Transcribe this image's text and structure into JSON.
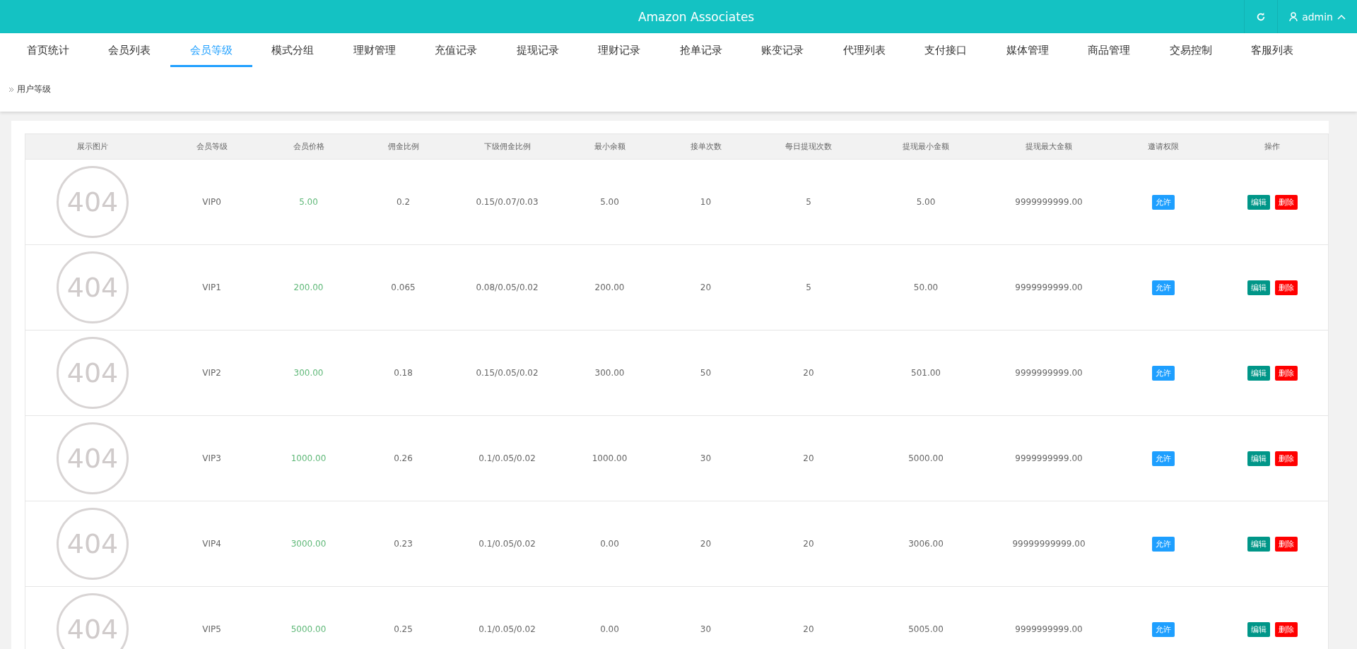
{
  "header": {
    "title": "Amazon Associates",
    "user": "admin"
  },
  "nav": [
    {
      "label": "首页统计",
      "selected": false
    },
    {
      "label": "会员列表",
      "selected": false
    },
    {
      "label": "会员等级",
      "selected": true
    },
    {
      "label": "模式分组",
      "selected": false
    },
    {
      "label": "理财管理",
      "selected": false
    },
    {
      "label": "充值记录",
      "selected": false
    },
    {
      "label": "提现记录",
      "selected": false
    },
    {
      "label": "理财记录",
      "selected": false
    },
    {
      "label": "抢单记录",
      "selected": false
    },
    {
      "label": "账变记录",
      "selected": false
    },
    {
      "label": "代理列表",
      "selected": false
    },
    {
      "label": "支付接口",
      "selected": false
    },
    {
      "label": "媒体管理",
      "selected": false
    },
    {
      "label": "商品管理",
      "selected": false
    },
    {
      "label": "交易控制",
      "selected": false
    },
    {
      "label": "客服列表",
      "selected": false
    }
  ],
  "breadcrumb": "用户等级",
  "table": {
    "columns": [
      "展示图片",
      "会员等级",
      "会员价格",
      "佣金比例",
      "下级佣金比例",
      "最小余额",
      "接单次数",
      "每日提现次数",
      "提现最小金额",
      "提现最大金额",
      "邀请权限",
      "操作"
    ],
    "rows": [
      {
        "image_text": "404",
        "level": "VIP0",
        "price": "5.00",
        "commission": "0.2",
        "sub_commission": "0.15/0.07/0.03",
        "min_balance": "5.00",
        "orders": "10",
        "daily_withdrawals": "5",
        "withdraw_min": "5.00",
        "withdraw_max": "9999999999.00",
        "invite": "允许",
        "edit": "编辑",
        "delete": "删除"
      },
      {
        "image_text": "404",
        "level": "VIP1",
        "price": "200.00",
        "commission": "0.065",
        "sub_commission": "0.08/0.05/0.02",
        "min_balance": "200.00",
        "orders": "20",
        "daily_withdrawals": "5",
        "withdraw_min": "50.00",
        "withdraw_max": "9999999999.00",
        "invite": "允许",
        "edit": "编辑",
        "delete": "删除"
      },
      {
        "image_text": "404",
        "level": "VIP2",
        "price": "300.00",
        "commission": "0.18",
        "sub_commission": "0.15/0.05/0.02",
        "min_balance": "300.00",
        "orders": "50",
        "daily_withdrawals": "20",
        "withdraw_min": "501.00",
        "withdraw_max": "9999999999.00",
        "invite": "允许",
        "edit": "编辑",
        "delete": "删除"
      },
      {
        "image_text": "404",
        "level": "VIP3",
        "price": "1000.00",
        "commission": "0.26",
        "sub_commission": "0.1/0.05/0.02",
        "min_balance": "1000.00",
        "orders": "30",
        "daily_withdrawals": "20",
        "withdraw_min": "5000.00",
        "withdraw_max": "9999999999.00",
        "invite": "允许",
        "edit": "编辑",
        "delete": "删除"
      },
      {
        "image_text": "404",
        "level": "VIP4",
        "price": "3000.00",
        "commission": "0.23",
        "sub_commission": "0.1/0.05/0.02",
        "min_balance": "0.00",
        "orders": "20",
        "daily_withdrawals": "20",
        "withdraw_min": "3006.00",
        "withdraw_max": "99999999999.00",
        "invite": "允许",
        "edit": "编辑",
        "delete": "删除"
      },
      {
        "image_text": "404",
        "level": "VIP5",
        "price": "5000.00",
        "commission": "0.25",
        "sub_commission": "0.1/0.05/0.02",
        "min_balance": "0.00",
        "orders": "30",
        "daily_withdrawals": "20",
        "withdraw_min": "5005.00",
        "withdraw_max": "9999999999.00",
        "invite": "允许",
        "edit": "编辑",
        "delete": "删除"
      }
    ]
  }
}
